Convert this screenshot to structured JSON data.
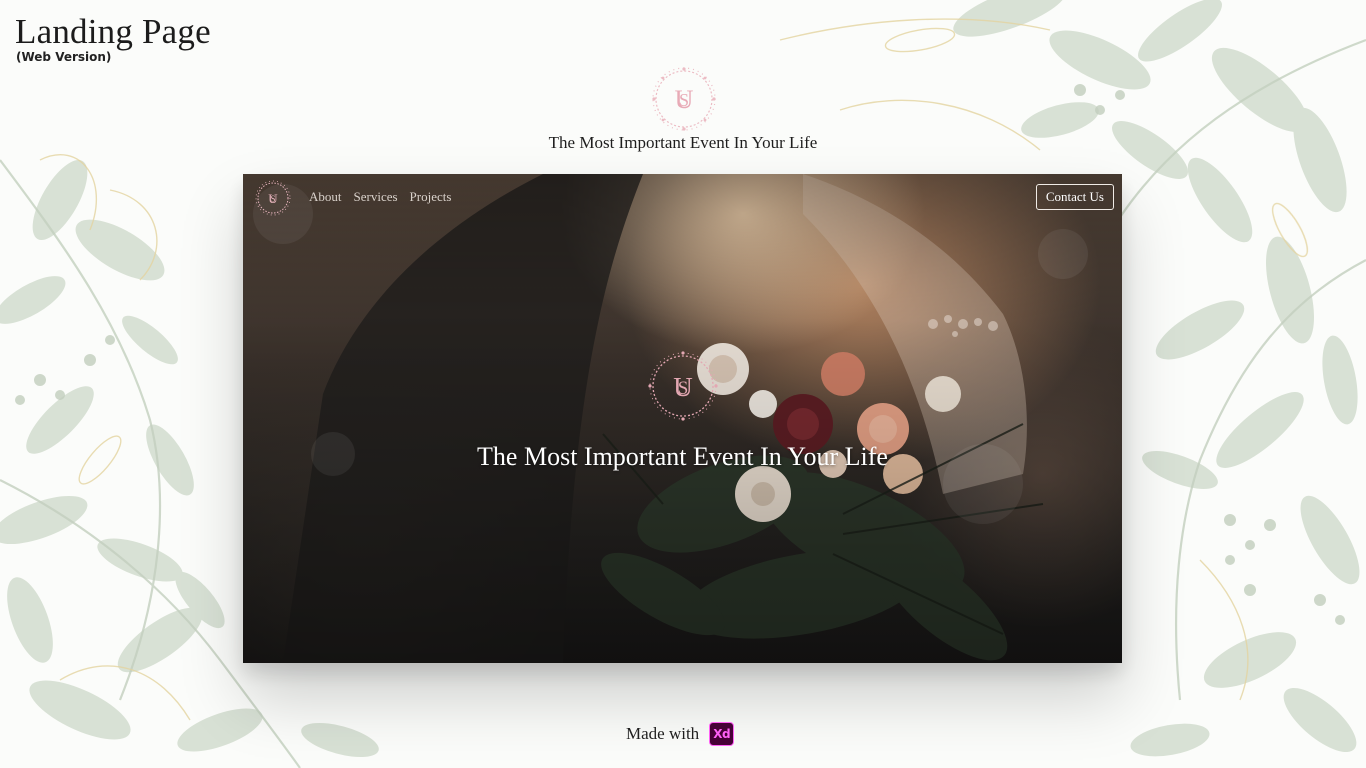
{
  "header": {
    "title": "Landing Page",
    "subtitle": "(Web Version)"
  },
  "top_section": {
    "logo": "monogram-wreath-icon",
    "tagline": "The Most Important Event In Your Life"
  },
  "site_preview": {
    "nav": {
      "logo": "monogram-wreath-icon",
      "links": [
        {
          "label": "About"
        },
        {
          "label": "Services"
        },
        {
          "label": "Projects"
        }
      ],
      "contact_button": "Contact Us"
    },
    "hero": {
      "logo": "monogram-wreath-icon",
      "heading": "The Most Important Event In Your Life"
    }
  },
  "footer": {
    "made_with": "Made with",
    "tool_badge": "Xd"
  },
  "colors": {
    "background": "#fbfcfa",
    "leaf": "#c9d6c4",
    "gold_line": "#e6d6a6",
    "monogram_pink": "#e8b4bd",
    "xd_badge_bg": "#470137",
    "xd_badge_fg": "#ff61f6"
  }
}
